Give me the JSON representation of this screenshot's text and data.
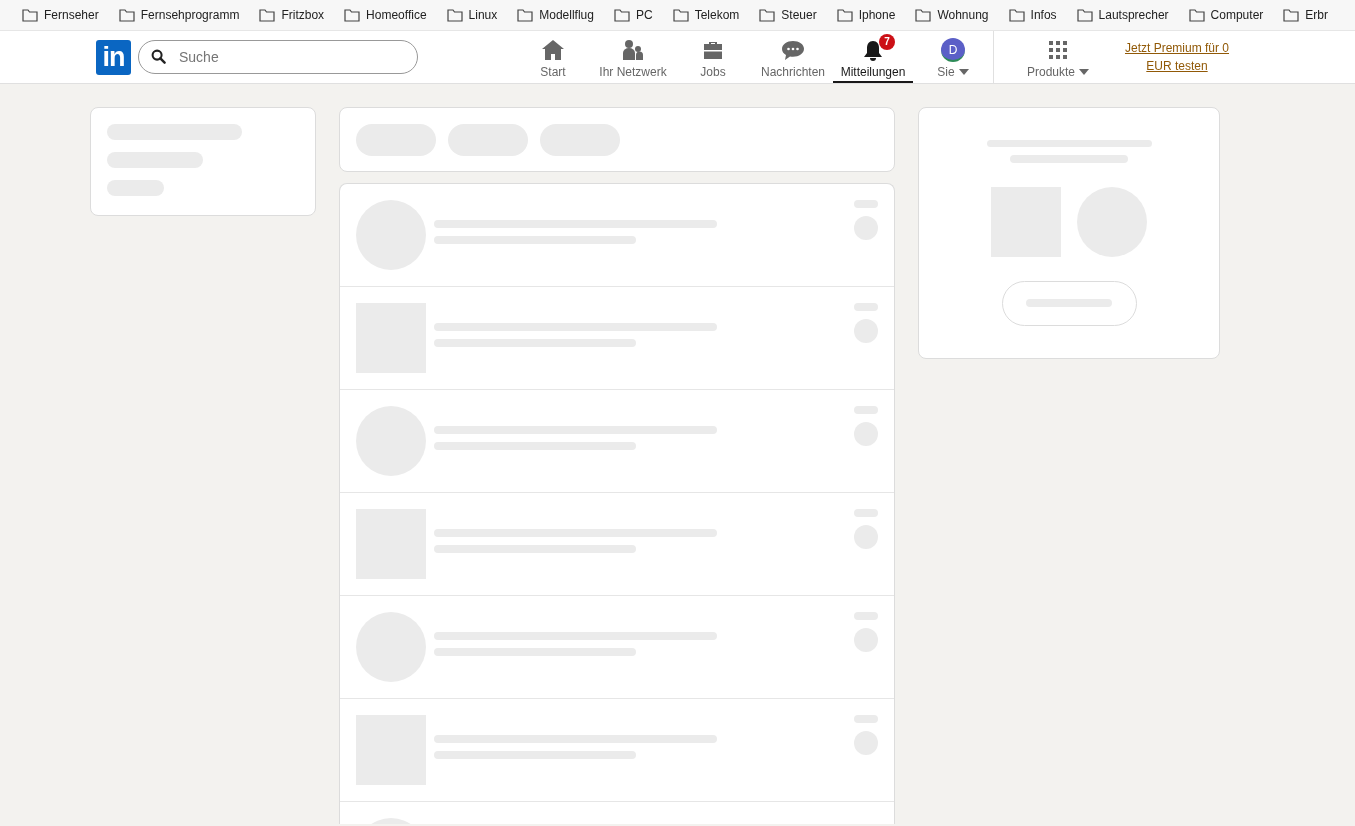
{
  "bookmarks": [
    "Fernseher",
    "Fernsehprogramm",
    "Fritzbox",
    "Homeoffice",
    "Linux",
    "Modellflug",
    "PC",
    "Telekom",
    "Steuer",
    "Iphone",
    "Wohnung",
    "Infos",
    "Lautsprecher",
    "Computer",
    "Erbr"
  ],
  "navbar": {
    "logo_text": "in",
    "search": {
      "placeholder": "Suche"
    },
    "items": [
      {
        "kind": "home",
        "label": "Start",
        "selected": false
      },
      {
        "kind": "network",
        "label": "Ihr Netzwerk",
        "selected": false
      },
      {
        "kind": "jobs",
        "label": "Jobs",
        "selected": false
      },
      {
        "kind": "messages",
        "label": "Nachrichten",
        "selected": false
      },
      {
        "kind": "bell",
        "label": "Mitteilungen",
        "selected": true,
        "badge": "7"
      },
      {
        "kind": "avatar",
        "label": "Sie",
        "selected": false,
        "avatar_text": "D",
        "dropdown": true
      }
    ],
    "products": {
      "label": "Produkte",
      "dropdown": true
    },
    "premium_link": "Jetzt Premium für 0 EUR testen"
  },
  "feed_placeholders": [
    {
      "kind": "circle"
    },
    {
      "kind": "square"
    },
    {
      "kind": "circle"
    },
    {
      "kind": "square"
    },
    {
      "kind": "circle"
    },
    {
      "kind": "square"
    },
    {
      "kind": "circle",
      "partial": true
    }
  ]
}
